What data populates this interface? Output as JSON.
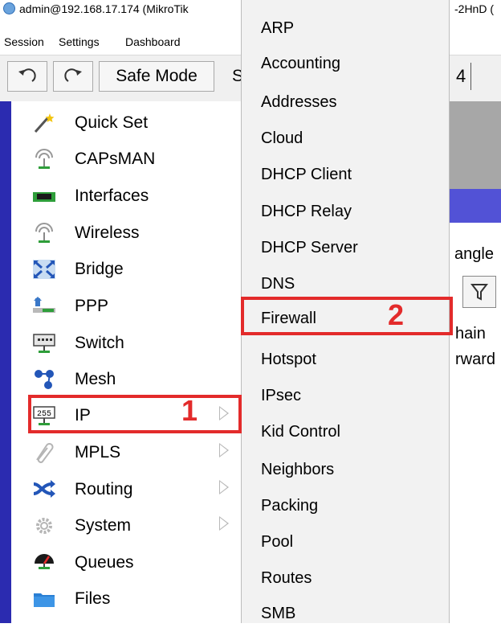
{
  "window": {
    "title": "admin@192.168.17.174 (MikroTik",
    "title_right": "-2HnD ("
  },
  "menubar": {
    "items": [
      "Session",
      "Settings",
      "Dashboard"
    ]
  },
  "toolbar": {
    "safe_mode_label": "Safe Mode",
    "partial_s": "S",
    "partial_4": "4"
  },
  "sidebar": {
    "items": [
      {
        "label": "Quick Set",
        "icon": "wand-icon",
        "has_submenu": false
      },
      {
        "label": "CAPsMAN",
        "icon": "antenna-icon",
        "has_submenu": false
      },
      {
        "label": "Interfaces",
        "icon": "network-card-icon",
        "has_submenu": false
      },
      {
        "label": "Wireless",
        "icon": "antenna-icon",
        "has_submenu": false
      },
      {
        "label": "Bridge",
        "icon": "bridge-icon",
        "has_submenu": false
      },
      {
        "label": "PPP",
        "icon": "ppp-icon",
        "has_submenu": false
      },
      {
        "label": "Switch",
        "icon": "switch-icon",
        "has_submenu": false
      },
      {
        "label": "Mesh",
        "icon": "mesh-icon",
        "has_submenu": false
      },
      {
        "label": "IP",
        "icon": "ip-icon",
        "has_submenu": true
      },
      {
        "label": "MPLS",
        "icon": "mpls-icon",
        "has_submenu": true
      },
      {
        "label": "Routing",
        "icon": "routing-icon",
        "has_submenu": true
      },
      {
        "label": "System",
        "icon": "gear-icon",
        "has_submenu": true
      },
      {
        "label": "Queues",
        "icon": "queues-icon",
        "has_submenu": false
      },
      {
        "label": "Files",
        "icon": "folder-icon",
        "has_submenu": false
      }
    ]
  },
  "ip_submenu": {
    "items": [
      "ARP",
      "Accounting",
      "Addresses",
      "Cloud",
      "DHCP Client",
      "DHCP Relay",
      "DHCP Server",
      "DNS",
      "Firewall",
      "Hotspot",
      "IPsec",
      "Kid Control",
      "Neighbors",
      "Packing",
      "Pool",
      "Routes",
      "SMB"
    ]
  },
  "background_window": {
    "tab_partial": "angle",
    "column_chain": "hain",
    "row_value": "rward"
  },
  "annotations": {
    "step1": "1",
    "step2": "2"
  },
  "colors": {
    "highlight": "#e32b2b",
    "sidebar_stripe": "#2b2bb0",
    "submenu_bg": "#f2f2f2"
  }
}
